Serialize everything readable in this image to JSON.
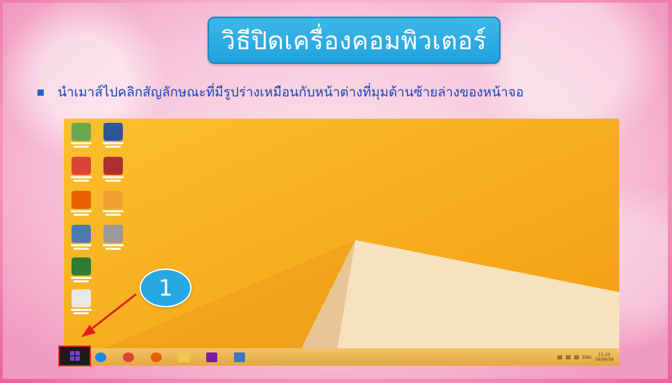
{
  "slide": {
    "title": "วิธีปิดเครื่องคอมพิวเตอร์",
    "bullet": "นำเมาส์ไปคลิกสัญลักษณะที่มีรูปร่างเหมือนกับหน้าต่างที่มุมด้านซ้ายล่างของหน้าจอ",
    "callout_number": "1"
  },
  "desktop": {
    "icons": [
      {
        "name": "camtasia-icon",
        "color": "#6aa84f"
      },
      {
        "name": "word-icon",
        "color": "#2b5797"
      },
      {
        "name": "chrome-icon",
        "color": "#db4437"
      },
      {
        "name": "fonts-tool-icon",
        "color": "#b03030"
      },
      {
        "name": "firefox-icon",
        "color": "#e66000"
      },
      {
        "name": "photoscape-icon",
        "color": "#f0a030"
      },
      {
        "name": "media-player-icon",
        "color": "#4a7ab0"
      },
      {
        "name": "keyboard-icon",
        "color": "#9a9a9a"
      },
      {
        "name": "game-icon",
        "color": "#2e7d32"
      },
      {
        "name": "document-icon",
        "color": "#e8e8e8"
      }
    ]
  },
  "taskbar": {
    "items": [
      {
        "name": "internet-explorer-icon",
        "color": "#1e88e5"
      },
      {
        "name": "chrome-icon",
        "color": "#db4437"
      },
      {
        "name": "firefox-icon",
        "color": "#e66000"
      },
      {
        "name": "file-explorer-icon",
        "color": "#f2c94c"
      },
      {
        "name": "search-icon",
        "color": "#7b1fa2"
      },
      {
        "name": "app-window-icon",
        "color": "#3c78c8"
      }
    ],
    "tray": {
      "language": "ENG",
      "time": "11:20",
      "date": "16/06/56"
    }
  },
  "colors": {
    "title_bg": "#21a2df",
    "bullet_text": "#1643b8",
    "highlight": "#e0201c",
    "wallpaper": "#f6b41e"
  }
}
